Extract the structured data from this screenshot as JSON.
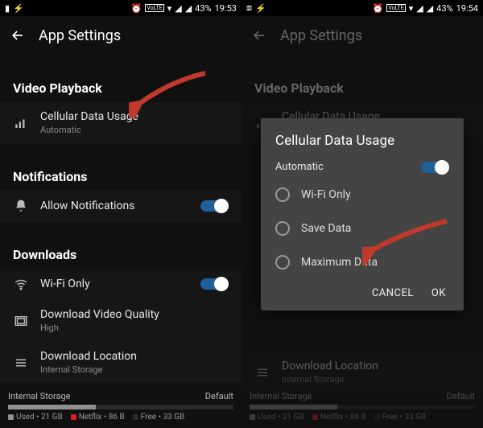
{
  "status": {
    "battery": "43%",
    "time_left": "19:53",
    "time_right": "19:54",
    "volte": "VoLTE"
  },
  "app": {
    "title": "App Settings"
  },
  "sections": {
    "video": {
      "header": "Video Playback",
      "cellular": {
        "label": "Cellular Data Usage",
        "value": "Automatic"
      }
    },
    "notif": {
      "header": "Notifications",
      "allow": {
        "label": "Allow Notifications"
      }
    },
    "downloads": {
      "header": "Downloads",
      "wifi": {
        "label": "Wi-Fi Only"
      },
      "quality": {
        "label": "Download Video Quality",
        "value": "High"
      },
      "location": {
        "label": "Download Location",
        "value": "Internal Storage"
      }
    }
  },
  "storage": {
    "title": "Internal Storage",
    "default_label": "Default",
    "used_pct": 39,
    "used_label": "Used",
    "used_val": "21 GB",
    "nf_label": "Netflix",
    "nf_val": "86 B",
    "free_label": "Free",
    "free_val": "33 GB"
  },
  "dialog": {
    "title": "Cellular Data Usage",
    "automatic": "Automatic",
    "opts": {
      "wifi": "Wi-Fi Only",
      "save": "Save Data",
      "max": "Maximum Data"
    },
    "cancel": "CANCEL",
    "ok": "OK"
  },
  "colors": {
    "arrow": "#c0392b"
  }
}
